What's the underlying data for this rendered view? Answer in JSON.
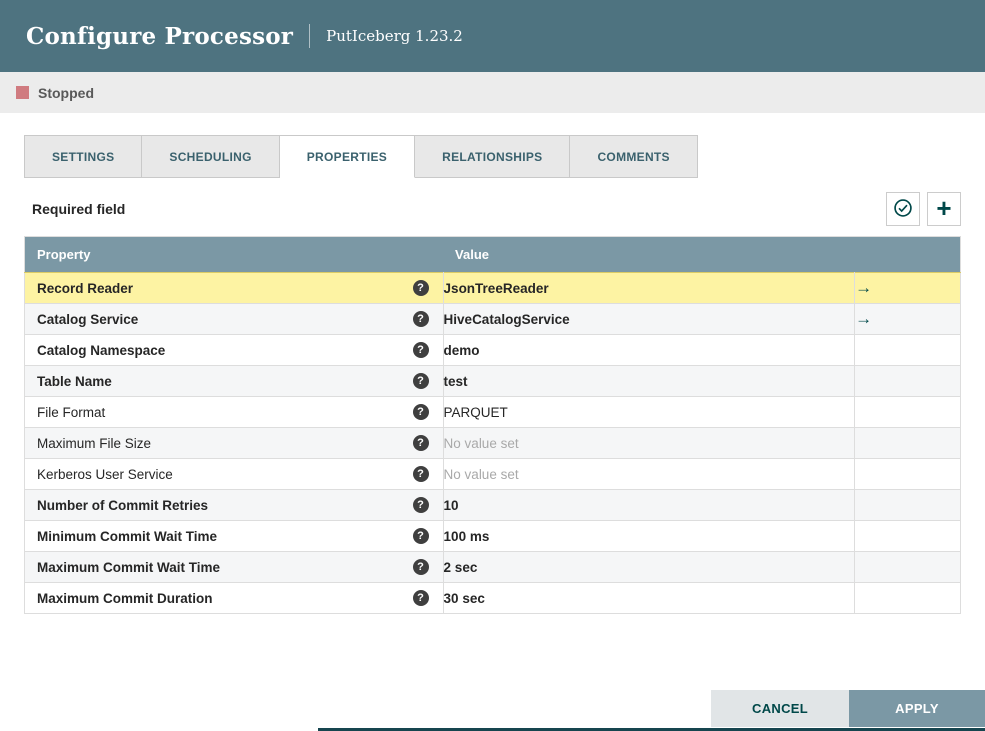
{
  "header": {
    "title": "Configure Processor",
    "subtitle": "PutIceberg 1.23.2"
  },
  "status": {
    "label": "Stopped"
  },
  "tabs": [
    {
      "label": "SETTINGS",
      "active": false
    },
    {
      "label": "SCHEDULING",
      "active": false
    },
    {
      "label": "PROPERTIES",
      "active": true
    },
    {
      "label": "RELATIONSHIPS",
      "active": false
    },
    {
      "label": "COMMENTS",
      "active": false
    }
  ],
  "toolbar": {
    "required_label": "Required field",
    "verify_button_icon": "check-circle-icon",
    "add_button_icon": "plus-icon"
  },
  "icons": {
    "plus_glyph": "+",
    "help_glyph": "?",
    "goto_glyph": "→"
  },
  "table": {
    "columns": [
      "Property",
      "Value"
    ],
    "rows": [
      {
        "property": "Record Reader",
        "value": "JsonTreeReader",
        "required": true,
        "placeholder": false,
        "has_arrow": true,
        "selected": true
      },
      {
        "property": "Catalog Service",
        "value": "HiveCatalogService",
        "required": true,
        "placeholder": false,
        "has_arrow": true,
        "selected": false
      },
      {
        "property": "Catalog Namespace",
        "value": "demo",
        "required": true,
        "placeholder": false,
        "has_arrow": false,
        "selected": false
      },
      {
        "property": "Table Name",
        "value": "test",
        "required": true,
        "placeholder": false,
        "has_arrow": false,
        "selected": false
      },
      {
        "property": "File Format",
        "value": "PARQUET",
        "required": false,
        "placeholder": false,
        "has_arrow": false,
        "selected": false
      },
      {
        "property": "Maximum File Size",
        "value": "No value set",
        "required": false,
        "placeholder": true,
        "has_arrow": false,
        "selected": false
      },
      {
        "property": "Kerberos User Service",
        "value": "No value set",
        "required": false,
        "placeholder": true,
        "has_arrow": false,
        "selected": false
      },
      {
        "property": "Number of Commit Retries",
        "value": "10",
        "required": true,
        "placeholder": false,
        "has_arrow": false,
        "selected": false
      },
      {
        "property": "Minimum Commit Wait Time",
        "value": "100 ms",
        "required": true,
        "placeholder": false,
        "has_arrow": false,
        "selected": false
      },
      {
        "property": "Maximum Commit Wait Time",
        "value": "2 sec",
        "required": true,
        "placeholder": false,
        "has_arrow": false,
        "selected": false
      },
      {
        "property": "Maximum Commit Duration",
        "value": "30 sec",
        "required": true,
        "placeholder": false,
        "has_arrow": false,
        "selected": false
      }
    ]
  },
  "footer": {
    "cancel_label": "CANCEL",
    "apply_label": "APPLY"
  },
  "colors": {
    "header_bg": "#4e7380",
    "status_bar_bg": "#ececec",
    "stopped_red": "#d07b80",
    "accent_teal": "#004849",
    "tab_text": "#3a616d",
    "table_header_bg": "#7b98a5",
    "selected_row_bg": "#fdf3a3",
    "selected_row_border": "#dbcb66",
    "alt_row_bg": "#f5f6f7",
    "no_value_text": "#a9a9a9",
    "cancel_bg": "#e1e5e7",
    "apply_bg": "#7b98a5"
  }
}
